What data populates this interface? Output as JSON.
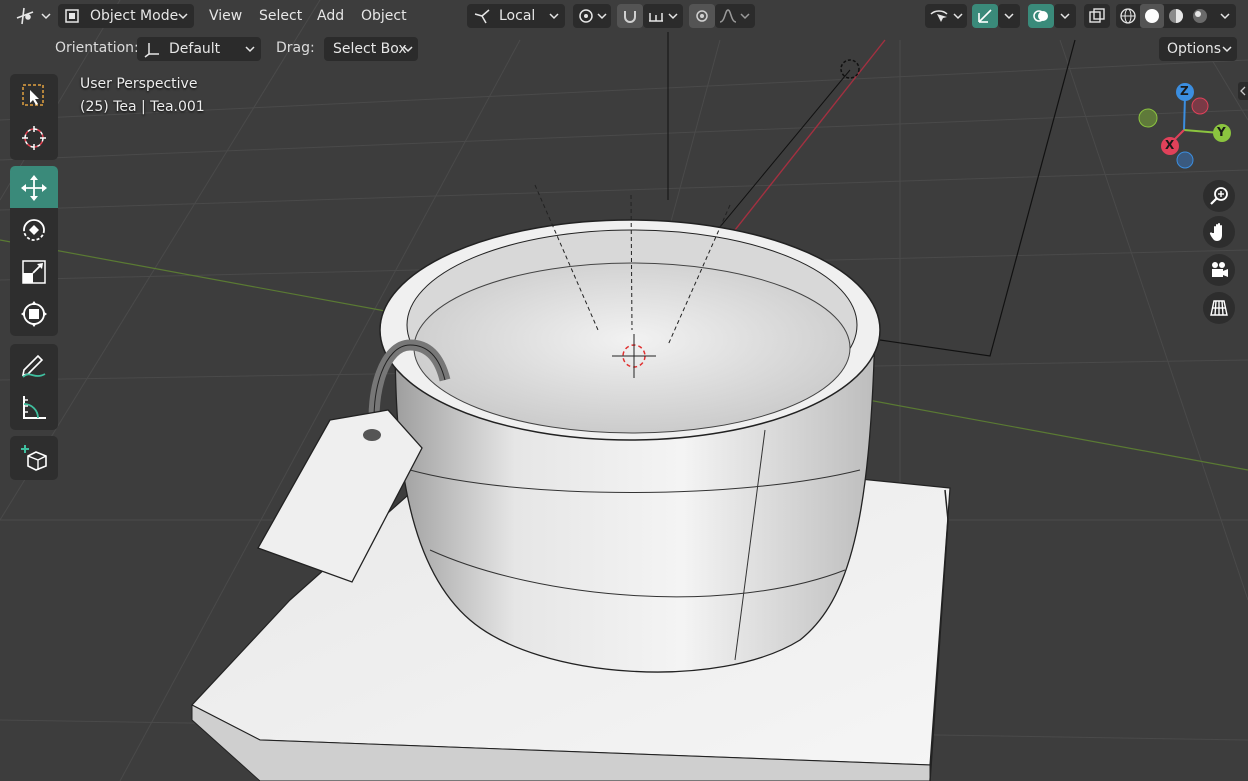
{
  "header": {
    "mode_label": "Object Mode",
    "menus": [
      "View",
      "Select",
      "Add",
      "Object"
    ],
    "pivot_label": "Local"
  },
  "tool_settings": {
    "orientation_label": "Orientation:",
    "orientation_value": "Default",
    "drag_label": "Drag:",
    "drag_value": "Select Box",
    "options_label": "Options"
  },
  "viewport": {
    "view_name": "User Perspective",
    "object_info": "(25) Tea | Tea.001"
  },
  "gizmo": {
    "z_label": "Z",
    "y_label": "Y",
    "x_label": "X"
  },
  "colors": {
    "accent": "#3a8a7a",
    "axis_x": "#e0415a",
    "axis_y": "#8bc43f",
    "axis_z": "#3b8ee0",
    "background": "#3d3d3d"
  }
}
